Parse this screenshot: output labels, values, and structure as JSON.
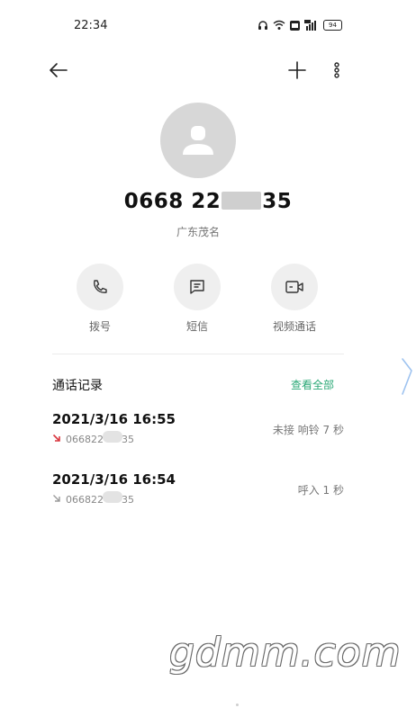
{
  "status_bar": {
    "time": "22:34",
    "battery": "94"
  },
  "contact": {
    "number_prefix": "0668 22",
    "number_suffix": "35",
    "location": "广东茂名"
  },
  "actions": [
    {
      "label": "拨号",
      "icon": "phone-icon"
    },
    {
      "label": "短信",
      "icon": "message-icon"
    },
    {
      "label": "视频通话",
      "icon": "video-call-icon"
    }
  ],
  "call_log": {
    "title": "通话记录",
    "view_all": "查看全部",
    "entries": [
      {
        "datetime": "2021/3/16 16:55",
        "number_prefix": "066822",
        "number_suffix": "35",
        "status": "未接  响铃 7 秒",
        "type": "missed",
        "color": "#d9363e"
      },
      {
        "datetime": "2021/3/16 16:54",
        "number_prefix": "066822",
        "number_suffix": "35",
        "status": "呼入  1 秒",
        "type": "incoming",
        "color": "#9a9a9a"
      }
    ]
  },
  "watermark": "gdmm.com",
  "colors": {
    "accent": "#2aa876",
    "missed": "#d9363e",
    "avatar_bg": "#d7d7d7",
    "action_bg": "#efefef"
  }
}
